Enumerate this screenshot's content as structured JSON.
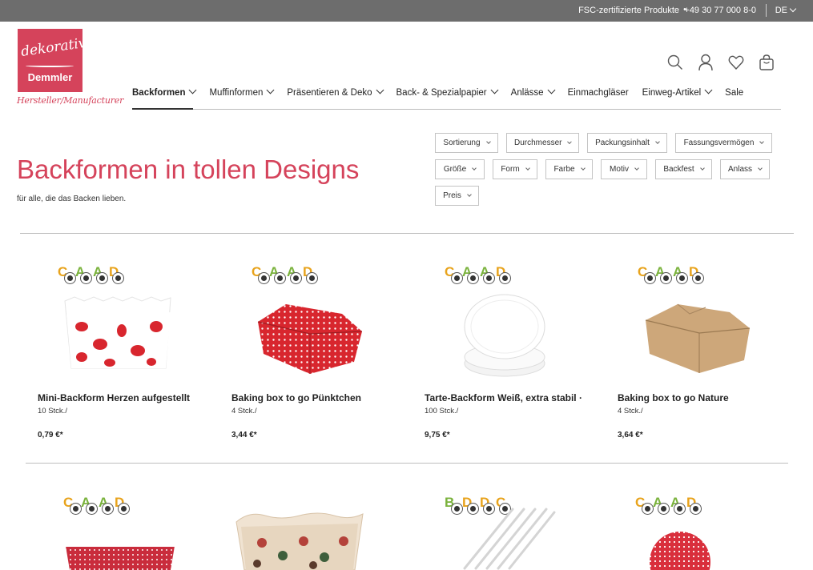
{
  "topbar": {
    "fsc": "FSC-zertifizierte Produkte",
    "dot": "•",
    "phone": "+49 30 77 000 8-0",
    "lang": "DE"
  },
  "logo": {
    "script": "dekorativ",
    "brand": "Demmler",
    "tagline": "Hersteller/Manufacturer"
  },
  "header_icons": [
    "search-icon",
    "account-icon",
    "wishlist-heart-icon",
    "cart-bag-icon"
  ],
  "nav": {
    "items": [
      {
        "label": "Backformen",
        "dropdown": true
      },
      {
        "label": "Muffinformen",
        "dropdown": true
      },
      {
        "label": "Präsentieren & Deko",
        "dropdown": true
      },
      {
        "label": "Back- & Spezialpapier",
        "dropdown": true
      },
      {
        "label": "Anlässe",
        "dropdown": true
      },
      {
        "label": "Einmachgläser",
        "dropdown": false
      },
      {
        "label": "Einweg-Artikel",
        "dropdown": true
      },
      {
        "label": "Sale",
        "dropdown": false
      }
    ]
  },
  "page": {
    "title": "Backformen in tollen Designs",
    "subtitle": "für alle, die das Backen lieben."
  },
  "filters": {
    "row1": [
      "Sortierung",
      "Durchmesser",
      "Packungsinhalt",
      "Fassungsvermögen"
    ],
    "row2": [
      "Größe",
      "Form",
      "Farbe",
      "Motiv",
      "Backfest",
      "Anlass"
    ],
    "row3": [
      "Preis"
    ]
  },
  "products": [
    {
      "name": "Mini-Backform Herzen aufgestellt",
      "qty": "10 Stck./",
      "price": "0,79 €*",
      "badges": [
        "C",
        "A",
        "A",
        "D"
      ]
    },
    {
      "name": "Baking box to go Pünktchen",
      "qty": "4 Stck./",
      "price": "3,44 €*",
      "badges": [
        "C",
        "A",
        "A",
        "D"
      ]
    },
    {
      "name": "Tarte-Backform Weiß, extra stabil ·",
      "qty": "100 Stck./",
      "price": "9,75 €*",
      "badges": [
        "C",
        "A",
        "A",
        "D"
      ]
    },
    {
      "name": "Baking box to go Nature",
      "qty": "4 Stck./",
      "price": "3,64 €*",
      "badges": [
        "C",
        "A",
        "A",
        "D"
      ]
    }
  ],
  "products_row2_badges": [
    [
      "C",
      "A",
      "A",
      "D"
    ],
    [],
    [
      "B",
      "D",
      "D",
      "C"
    ],
    [
      "C",
      "A",
      "A",
      "D"
    ]
  ],
  "colors": {
    "brand": "#d5435b",
    "topbar": "#6d6d6d",
    "badge_green": "#7ab23c",
    "badge_orange": "#e8a31c"
  }
}
